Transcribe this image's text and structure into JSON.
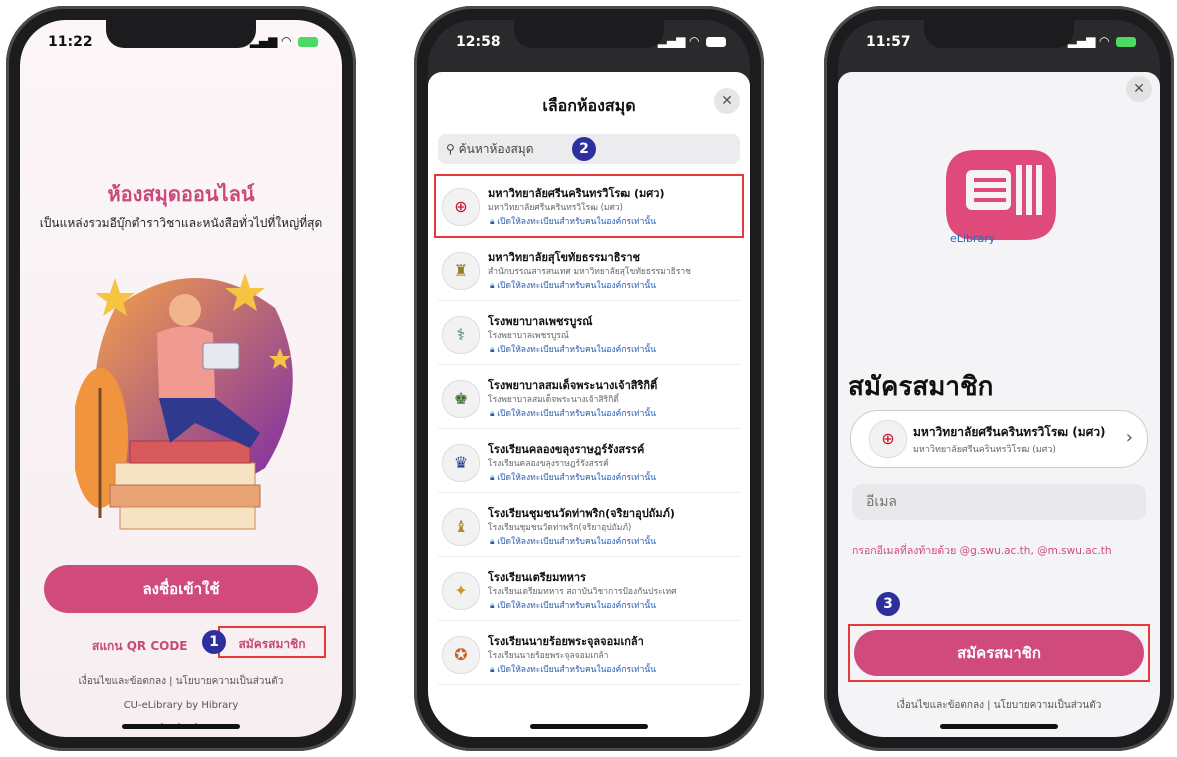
{
  "phone1": {
    "time": "11:22",
    "title": "ห้องสมุดออนไลน์",
    "subtitle": "เป็นแหล่งรวมอีบุ๊กตำราวิชาและหนังสือทั่วไปที่ใหญ่ที่สุด",
    "login_button": "ลงชื่อเข้าใช้",
    "scan_qr": "สแกน QR CODE",
    "register_link": "สมัครสมาชิก",
    "terms": "เงื่อนไขและข้อตกลง   |   นโยบายความเป็นส่วนตัว",
    "credit": "CU-eLibrary by Hibrary",
    "dots": "• • •",
    "step": "1"
  },
  "phone2": {
    "time": "12:58",
    "title": "เลือกห้องสมุด",
    "search_placeholder": "ค้นหาห้องสมุด",
    "step": "2",
    "libraries": [
      {
        "name": "มหาวิทยาลัยศรีนครินทรวิโรฒ (มศว)",
        "sub": "มหาวิทยาลัยศรีนครินทรวิโรฒ (มศว)",
        "note": "เปิดให้ลงทะเบียนสำหรับคนในองค์กรเท่านั้น"
      },
      {
        "name": "มหาวิทยาลัยสุโขทัยธรรมาธิราช",
        "sub": "สำนักบรรณสารสนเทศ มหาวิทยาลัยสุโขทัยธรรมาธิราช",
        "note": "เปิดให้ลงทะเบียนสำหรับคนในองค์กรเท่านั้น"
      },
      {
        "name": "โรงพยาบาลเพชรบูรณ์",
        "sub": "โรงพยาบาลเพชรบูรณ์",
        "note": "เปิดให้ลงทะเบียนสำหรับคนในองค์กรเท่านั้น"
      },
      {
        "name": "โรงพยาบาลสมเด็จพระนางเจ้าสิริกิติ์",
        "sub": "โรงพยาบาลสมเด็จพระนางเจ้าสิริกิติ์",
        "note": "เปิดให้ลงทะเบียนสำหรับคนในองค์กรเท่านั้น"
      },
      {
        "name": "โรงเรียนคลองขลุงราษฎร์รังสรรค์",
        "sub": "โรงเรียนคลองขลุงราษฎร์รังสรรค์",
        "note": "เปิดให้ลงทะเบียนสำหรับคนในองค์กรเท่านั้น"
      },
      {
        "name": "โรงเรียนชุมชนวัดท่าพริก(จริยาอุปถัมภ์)",
        "sub": "โรงเรียนชุมชนวัดท่าพริก(จริยาอุปถัมภ์)",
        "note": "เปิดให้ลงทะเบียนสำหรับคนในองค์กรเท่านั้น"
      },
      {
        "name": "โรงเรียนเตรียมทหาร",
        "sub": "โรงเรียนเตรียมทหาร สถาบันวิชาการป้องกันประเทศ",
        "note": "เปิดให้ลงทะเบียนสำหรับคนในองค์กรเท่านั้น"
      },
      {
        "name": "โรงเรียนนายร้อยพระจุลจอมเกล้า",
        "sub": "โรงเรียนนายร้อยพระจุลจอมเกล้า",
        "note": "เปิดให้ลงทะเบียนสำหรับคนในองค์กรเท่านั้น"
      }
    ]
  },
  "phone3": {
    "time": "11:57",
    "logo_text": "eLibrary",
    "title": "สมัครสมาชิก",
    "selected_library": "มหาวิทยาลัยศรีนครินทรวิโรฒ (มศว)",
    "selected_library_sub": "มหาวิทยาลัยศรีนครินทรวิโรฒ (มศว)",
    "email_placeholder": "อีเมล",
    "hint": "กรอกอีเมลที่ลงท้ายด้วย @g.swu.ac.th, @m.swu.ac.th",
    "register_button": "สมัครสมาชิก",
    "terms": "เงื่อนไขและข้อตกลง  |  นโยบายความเป็นส่วนตัว",
    "step": "3"
  },
  "colors": {
    "brand_pink": "#d04a7c",
    "highlight_red": "#e63a3a",
    "step_blue": "#2d2f9c"
  },
  "icons": [
    "search-icon",
    "close-icon",
    "lock-icon",
    "chevron-right-icon",
    "signal-icon",
    "wifi-icon",
    "battery-icon"
  ]
}
